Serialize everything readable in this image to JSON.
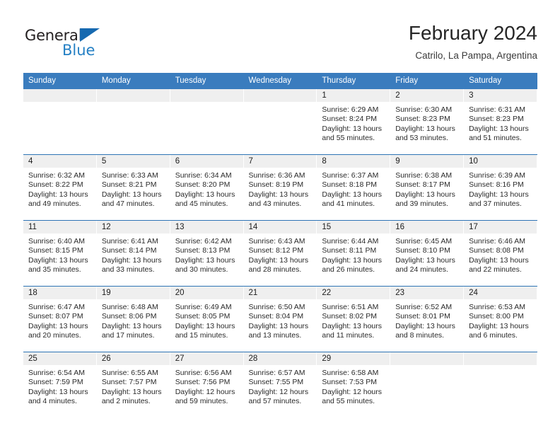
{
  "brand": {
    "name_top": "General",
    "name_bottom": "Blue",
    "triangle_icon": "brand-triangle-icon",
    "color_dark": "#231f20",
    "color_blue": "#2580c4"
  },
  "header": {
    "title": "February 2024",
    "subtitle": "Catrilo, La Pampa, Argentina"
  },
  "colors": {
    "header_blue": "#3a7cbe",
    "row_rule_blue": "#2e74b5",
    "daynum_band": "#efefef"
  },
  "calendar": {
    "weekday_headers": [
      "Sunday",
      "Monday",
      "Tuesday",
      "Wednesday",
      "Thursday",
      "Friday",
      "Saturday"
    ],
    "weeks": [
      [
        {
          "day": "",
          "empty": true,
          "sunrise": "",
          "sunset": "",
          "daylight_line1": "",
          "daylight_line2": ""
        },
        {
          "day": "",
          "empty": true,
          "sunrise": "",
          "sunset": "",
          "daylight_line1": "",
          "daylight_line2": ""
        },
        {
          "day": "",
          "empty": true,
          "sunrise": "",
          "sunset": "",
          "daylight_line1": "",
          "daylight_line2": ""
        },
        {
          "day": "",
          "empty": true,
          "sunrise": "",
          "sunset": "",
          "daylight_line1": "",
          "daylight_line2": ""
        },
        {
          "day": "1",
          "empty": false,
          "sunrise": "Sunrise: 6:29 AM",
          "sunset": "Sunset: 8:24 PM",
          "daylight_line1": "Daylight: 13 hours",
          "daylight_line2": "and 55 minutes."
        },
        {
          "day": "2",
          "empty": false,
          "sunrise": "Sunrise: 6:30 AM",
          "sunset": "Sunset: 8:23 PM",
          "daylight_line1": "Daylight: 13 hours",
          "daylight_line2": "and 53 minutes."
        },
        {
          "day": "3",
          "empty": false,
          "sunrise": "Sunrise: 6:31 AM",
          "sunset": "Sunset: 8:23 PM",
          "daylight_line1": "Daylight: 13 hours",
          "daylight_line2": "and 51 minutes."
        }
      ],
      [
        {
          "day": "4",
          "empty": false,
          "sunrise": "Sunrise: 6:32 AM",
          "sunset": "Sunset: 8:22 PM",
          "daylight_line1": "Daylight: 13 hours",
          "daylight_line2": "and 49 minutes."
        },
        {
          "day": "5",
          "empty": false,
          "sunrise": "Sunrise: 6:33 AM",
          "sunset": "Sunset: 8:21 PM",
          "daylight_line1": "Daylight: 13 hours",
          "daylight_line2": "and 47 minutes."
        },
        {
          "day": "6",
          "empty": false,
          "sunrise": "Sunrise: 6:34 AM",
          "sunset": "Sunset: 8:20 PM",
          "daylight_line1": "Daylight: 13 hours",
          "daylight_line2": "and 45 minutes."
        },
        {
          "day": "7",
          "empty": false,
          "sunrise": "Sunrise: 6:36 AM",
          "sunset": "Sunset: 8:19 PM",
          "daylight_line1": "Daylight: 13 hours",
          "daylight_line2": "and 43 minutes."
        },
        {
          "day": "8",
          "empty": false,
          "sunrise": "Sunrise: 6:37 AM",
          "sunset": "Sunset: 8:18 PM",
          "daylight_line1": "Daylight: 13 hours",
          "daylight_line2": "and 41 minutes."
        },
        {
          "day": "9",
          "empty": false,
          "sunrise": "Sunrise: 6:38 AM",
          "sunset": "Sunset: 8:17 PM",
          "daylight_line1": "Daylight: 13 hours",
          "daylight_line2": "and 39 minutes."
        },
        {
          "day": "10",
          "empty": false,
          "sunrise": "Sunrise: 6:39 AM",
          "sunset": "Sunset: 8:16 PM",
          "daylight_line1": "Daylight: 13 hours",
          "daylight_line2": "and 37 minutes."
        }
      ],
      [
        {
          "day": "11",
          "empty": false,
          "sunrise": "Sunrise: 6:40 AM",
          "sunset": "Sunset: 8:15 PM",
          "daylight_line1": "Daylight: 13 hours",
          "daylight_line2": "and 35 minutes."
        },
        {
          "day": "12",
          "empty": false,
          "sunrise": "Sunrise: 6:41 AM",
          "sunset": "Sunset: 8:14 PM",
          "daylight_line1": "Daylight: 13 hours",
          "daylight_line2": "and 33 minutes."
        },
        {
          "day": "13",
          "empty": false,
          "sunrise": "Sunrise: 6:42 AM",
          "sunset": "Sunset: 8:13 PM",
          "daylight_line1": "Daylight: 13 hours",
          "daylight_line2": "and 30 minutes."
        },
        {
          "day": "14",
          "empty": false,
          "sunrise": "Sunrise: 6:43 AM",
          "sunset": "Sunset: 8:12 PM",
          "daylight_line1": "Daylight: 13 hours",
          "daylight_line2": "and 28 minutes."
        },
        {
          "day": "15",
          "empty": false,
          "sunrise": "Sunrise: 6:44 AM",
          "sunset": "Sunset: 8:11 PM",
          "daylight_line1": "Daylight: 13 hours",
          "daylight_line2": "and 26 minutes."
        },
        {
          "day": "16",
          "empty": false,
          "sunrise": "Sunrise: 6:45 AM",
          "sunset": "Sunset: 8:10 PM",
          "daylight_line1": "Daylight: 13 hours",
          "daylight_line2": "and 24 minutes."
        },
        {
          "day": "17",
          "empty": false,
          "sunrise": "Sunrise: 6:46 AM",
          "sunset": "Sunset: 8:08 PM",
          "daylight_line1": "Daylight: 13 hours",
          "daylight_line2": "and 22 minutes."
        }
      ],
      [
        {
          "day": "18",
          "empty": false,
          "sunrise": "Sunrise: 6:47 AM",
          "sunset": "Sunset: 8:07 PM",
          "daylight_line1": "Daylight: 13 hours",
          "daylight_line2": "and 20 minutes."
        },
        {
          "day": "19",
          "empty": false,
          "sunrise": "Sunrise: 6:48 AM",
          "sunset": "Sunset: 8:06 PM",
          "daylight_line1": "Daylight: 13 hours",
          "daylight_line2": "and 17 minutes."
        },
        {
          "day": "20",
          "empty": false,
          "sunrise": "Sunrise: 6:49 AM",
          "sunset": "Sunset: 8:05 PM",
          "daylight_line1": "Daylight: 13 hours",
          "daylight_line2": "and 15 minutes."
        },
        {
          "day": "21",
          "empty": false,
          "sunrise": "Sunrise: 6:50 AM",
          "sunset": "Sunset: 8:04 PM",
          "daylight_line1": "Daylight: 13 hours",
          "daylight_line2": "and 13 minutes."
        },
        {
          "day": "22",
          "empty": false,
          "sunrise": "Sunrise: 6:51 AM",
          "sunset": "Sunset: 8:02 PM",
          "daylight_line1": "Daylight: 13 hours",
          "daylight_line2": "and 11 minutes."
        },
        {
          "day": "23",
          "empty": false,
          "sunrise": "Sunrise: 6:52 AM",
          "sunset": "Sunset: 8:01 PM",
          "daylight_line1": "Daylight: 13 hours",
          "daylight_line2": "and 8 minutes."
        },
        {
          "day": "24",
          "empty": false,
          "sunrise": "Sunrise: 6:53 AM",
          "sunset": "Sunset: 8:00 PM",
          "daylight_line1": "Daylight: 13 hours",
          "daylight_line2": "and 6 minutes."
        }
      ],
      [
        {
          "day": "25",
          "empty": false,
          "sunrise": "Sunrise: 6:54 AM",
          "sunset": "Sunset: 7:59 PM",
          "daylight_line1": "Daylight: 13 hours",
          "daylight_line2": "and 4 minutes."
        },
        {
          "day": "26",
          "empty": false,
          "sunrise": "Sunrise: 6:55 AM",
          "sunset": "Sunset: 7:57 PM",
          "daylight_line1": "Daylight: 13 hours",
          "daylight_line2": "and 2 minutes."
        },
        {
          "day": "27",
          "empty": false,
          "sunrise": "Sunrise: 6:56 AM",
          "sunset": "Sunset: 7:56 PM",
          "daylight_line1": "Daylight: 12 hours",
          "daylight_line2": "and 59 minutes."
        },
        {
          "day": "28",
          "empty": false,
          "sunrise": "Sunrise: 6:57 AM",
          "sunset": "Sunset: 7:55 PM",
          "daylight_line1": "Daylight: 12 hours",
          "daylight_line2": "and 57 minutes."
        },
        {
          "day": "29",
          "empty": false,
          "sunrise": "Sunrise: 6:58 AM",
          "sunset": "Sunset: 7:53 PM",
          "daylight_line1": "Daylight: 12 hours",
          "daylight_line2": "and 55 minutes."
        },
        {
          "day": "",
          "empty": true,
          "sunrise": "",
          "sunset": "",
          "daylight_line1": "",
          "daylight_line2": ""
        },
        {
          "day": "",
          "empty": true,
          "sunrise": "",
          "sunset": "",
          "daylight_line1": "",
          "daylight_line2": ""
        }
      ]
    ]
  }
}
